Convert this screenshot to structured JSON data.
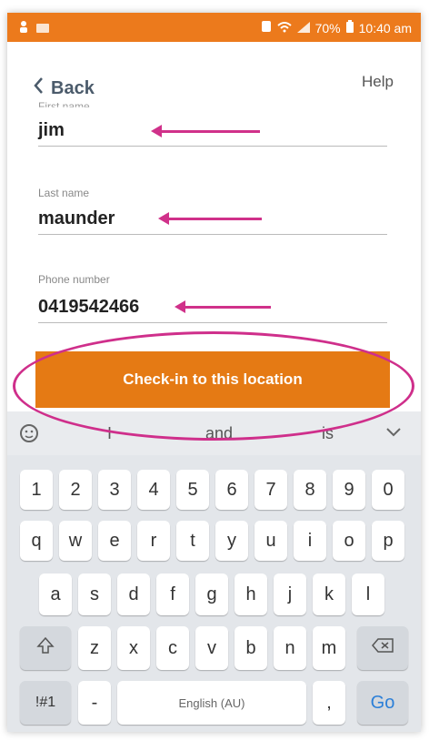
{
  "status_bar": {
    "battery": "70%",
    "time": "10:40 am",
    "icons": [
      "person-icon",
      "message-icon",
      "alarm-icon",
      "wifi-icon",
      "signal-icon",
      "battery-icon"
    ]
  },
  "nav": {
    "back_label": "Back",
    "help_label": "Help"
  },
  "form": {
    "first_name": {
      "label": "First name",
      "value": "jim"
    },
    "last_name": {
      "label": "Last name",
      "value": "maunder"
    },
    "phone": {
      "label": "Phone number",
      "value": "0419542466"
    }
  },
  "checkin_button": {
    "label": "Check-in to this location"
  },
  "suggestions": {
    "items": [
      "I",
      "and",
      "is"
    ]
  },
  "keyboard": {
    "row1": [
      "1",
      "2",
      "3",
      "4",
      "5",
      "6",
      "7",
      "8",
      "9",
      "0"
    ],
    "row2": [
      "q",
      "w",
      "e",
      "r",
      "t",
      "y",
      "u",
      "i",
      "o",
      "p"
    ],
    "row3": [
      "a",
      "s",
      "d",
      "f",
      "g",
      "h",
      "j",
      "k",
      "l"
    ],
    "row4": [
      "z",
      "x",
      "c",
      "v",
      "b",
      "n",
      "m"
    ],
    "symbols_key": "!#1",
    "dash_key": "-",
    "space_label": "English (AU)",
    "comma_key": ",",
    "go_key": "Go"
  },
  "colors": {
    "accent": "#ec7a1c",
    "annotation": "#d0318a"
  }
}
